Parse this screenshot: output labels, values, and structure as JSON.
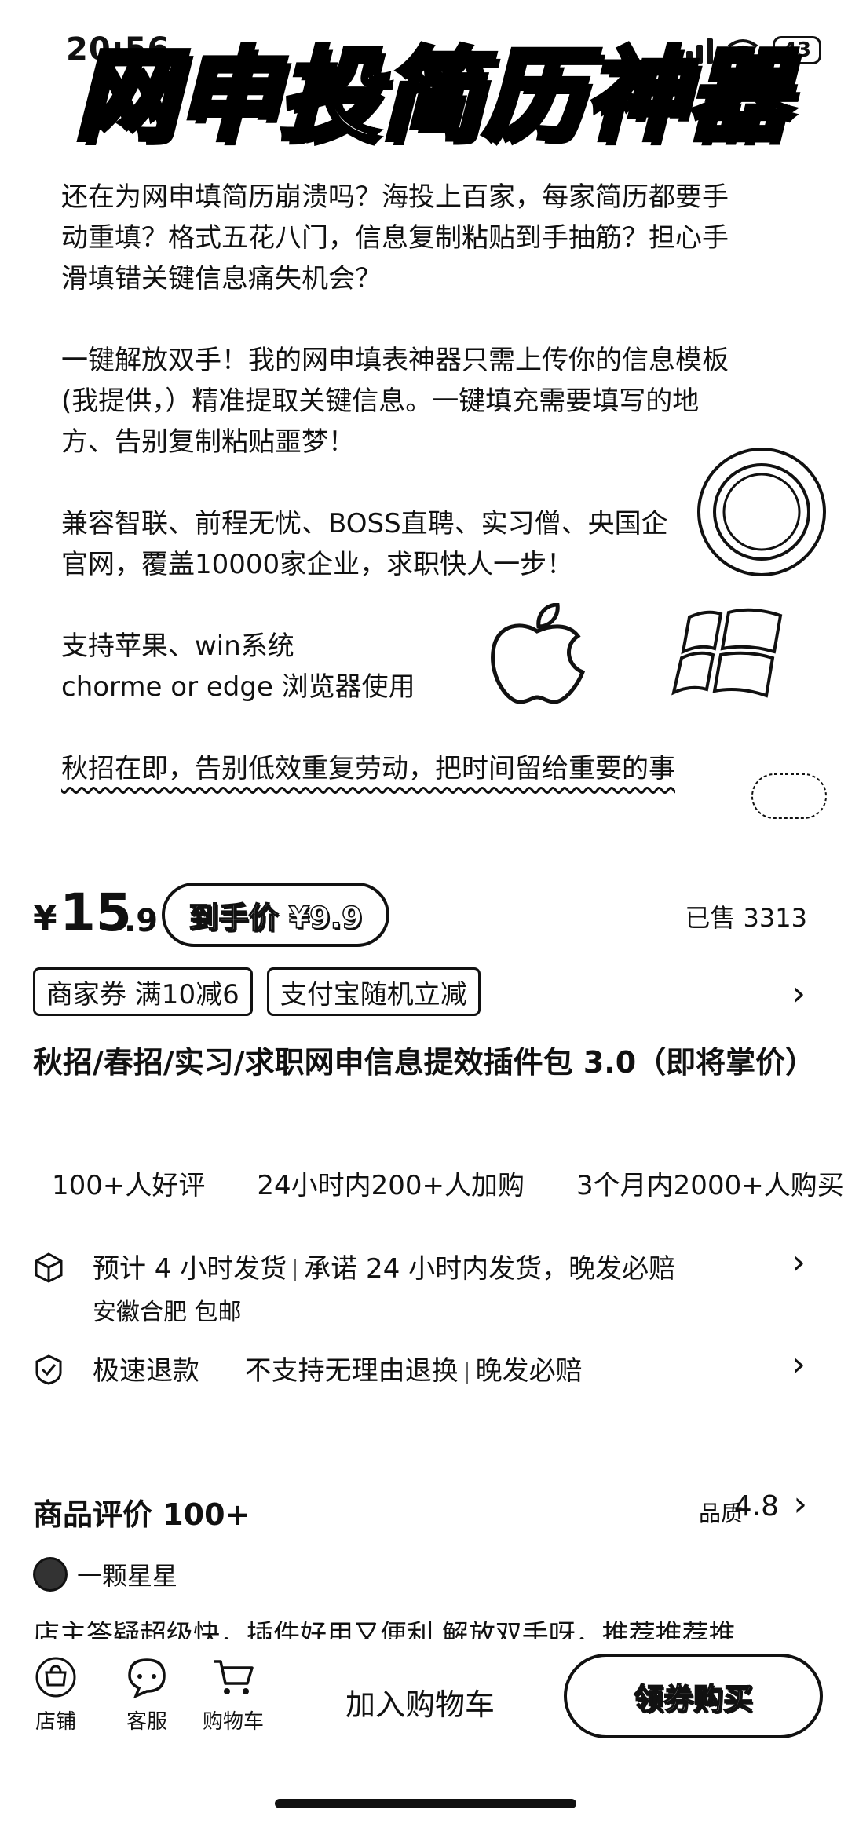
{
  "status_bar": {
    "time": "20:56",
    "battery": "43"
  },
  "banner": {
    "title": "网申投简历神器"
  },
  "promo": {
    "paragraph1": "还在为网申填简历崩溃吗？海投上百家，每家简历都要手\n动重填？格式五花八门，信息复制粘贴到手抽筋？担心手\n滑填错关键信息痛失机会？",
    "paragraph2": "一键解放双手！我的网申填表神器只需上传你的信息模板\n(我提供，）精准提取关键信息。一键填充需要填写的地\n方、告别复制粘贴噩梦！",
    "paragraph3": "兼容智联、前程无忧、BOSS直聘、实习僧、央国企\n官网，覆盖10000家企业，求职快人一步！",
    "support_line1": "支持苹果、win系统",
    "support_line2": "chorme or  edge 浏览器使用",
    "final_line": "秋招在即，告别低效重复劳动，把时间留给重要的事"
  },
  "price": {
    "currency": "¥",
    "main": "15",
    "decimal": ".9",
    "net_price_label": "到手价 ¥9.9",
    "sold": "已售 3313"
  },
  "coupons": [
    "商家券 满10减6",
    "支付宝随机立减"
  ],
  "product_title": "秋招/春招/实习/求职网申信息提效插件包 3.0（即将掌价）",
  "stats": [
    "100+人好评",
    "24小时内200+人加购",
    "3个月内2000+人购买"
  ],
  "shipping": {
    "estimate": "预计 4 小时发货",
    "promise": "承诺 24 小时内发货，晚发必赔",
    "origin": "安徽合肥 包邮"
  },
  "refund": {
    "label": "极速退款",
    "policy": "不支持无理由退换",
    "compensation": "晚发必赔"
  },
  "reviews": {
    "title": "商品评价 100+",
    "quality_label": "品质",
    "quality_score": "4.8",
    "reviewer_name": "一颗星星",
    "snippet": "店主答疑超级快，插件好用又便利 解放双手呀，推荐推荐推"
  },
  "bottom_bar": {
    "shop": "店铺",
    "service": "客服",
    "cart": "购物车",
    "add_to_cart": "加入购物车",
    "buy": "领券购买"
  }
}
